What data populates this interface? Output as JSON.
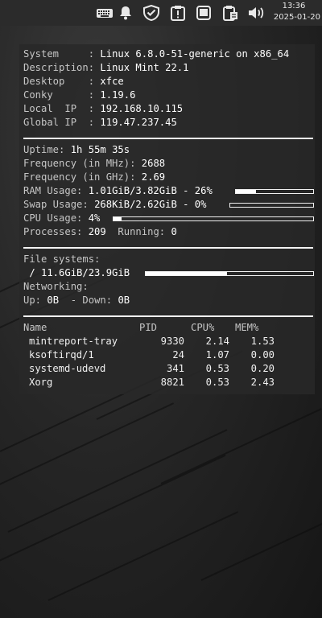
{
  "panel": {
    "time": "13:36",
    "date": "2025-01-20",
    "icons": [
      "keyboard-icon",
      "bell-icon",
      "shield-icon",
      "clipboard-icon",
      "window-icon",
      "clipboard-paste-icon",
      "speaker-icon"
    ]
  },
  "conky": {
    "system_info": [
      {
        "key": "System     :",
        "value": "Linux 6.8.0-51-generic on x86_64"
      },
      {
        "key": "Description:",
        "value": "Linux Mint 22.1"
      },
      {
        "key": "Desktop    :",
        "value": "xfce"
      },
      {
        "key": "Conky      :",
        "value": "1.19.6"
      },
      {
        "key": "Local  IP  :",
        "value": "192.168.10.115"
      },
      {
        "key": "Global IP  :",
        "value": "119.47.237.45"
      }
    ],
    "uptime": {
      "label": "Uptime:",
      "value": "1h 55m 35s"
    },
    "freq_mhz": {
      "label": "Frequency (in MHz):",
      "value": "2688"
    },
    "freq_ghz": {
      "label": "Frequency (in GHz):",
      "value": "2.69"
    },
    "ram": {
      "label": "RAM Usage:",
      "value": "1.01GiB/3.82GiB - 26%",
      "percent": 26
    },
    "swap": {
      "label": "Swap Usage:",
      "value": "268KiB/2.62GiB - 0%",
      "percent": 0
    },
    "cpu": {
      "label": "CPU Usage:",
      "value": "4%",
      "percent": 4
    },
    "processes": {
      "label": "Processes:",
      "value": "209",
      "running_label": "Running:",
      "running_value": "0"
    },
    "filesystems": {
      "label": "File systems:",
      "root": " / 11.6GiB/23.9GiB",
      "percent": 48.5
    },
    "networking": {
      "label": "Networking:",
      "up_label": "Up:",
      "up_value": "0B",
      "down_label": "- Down:",
      "down_value": "0B"
    },
    "process_table": {
      "headers": {
        "name": "Name",
        "pid": "PID",
        "cpu": "CPU%",
        "mem": "MEM%"
      },
      "rows": [
        {
          "name": "mintreport-tray",
          "pid": "9330",
          "cpu": "2.14",
          "mem": "1.53"
        },
        {
          "name": "ksoftirqd/1",
          "pid": "24",
          "cpu": "1.07",
          "mem": "0.00"
        },
        {
          "name": "systemd-udevd",
          "pid": "341",
          "cpu": "0.53",
          "mem": "0.20"
        },
        {
          "name": "Xorg",
          "pid": "8821",
          "cpu": "0.53",
          "mem": "2.43"
        }
      ]
    }
  }
}
